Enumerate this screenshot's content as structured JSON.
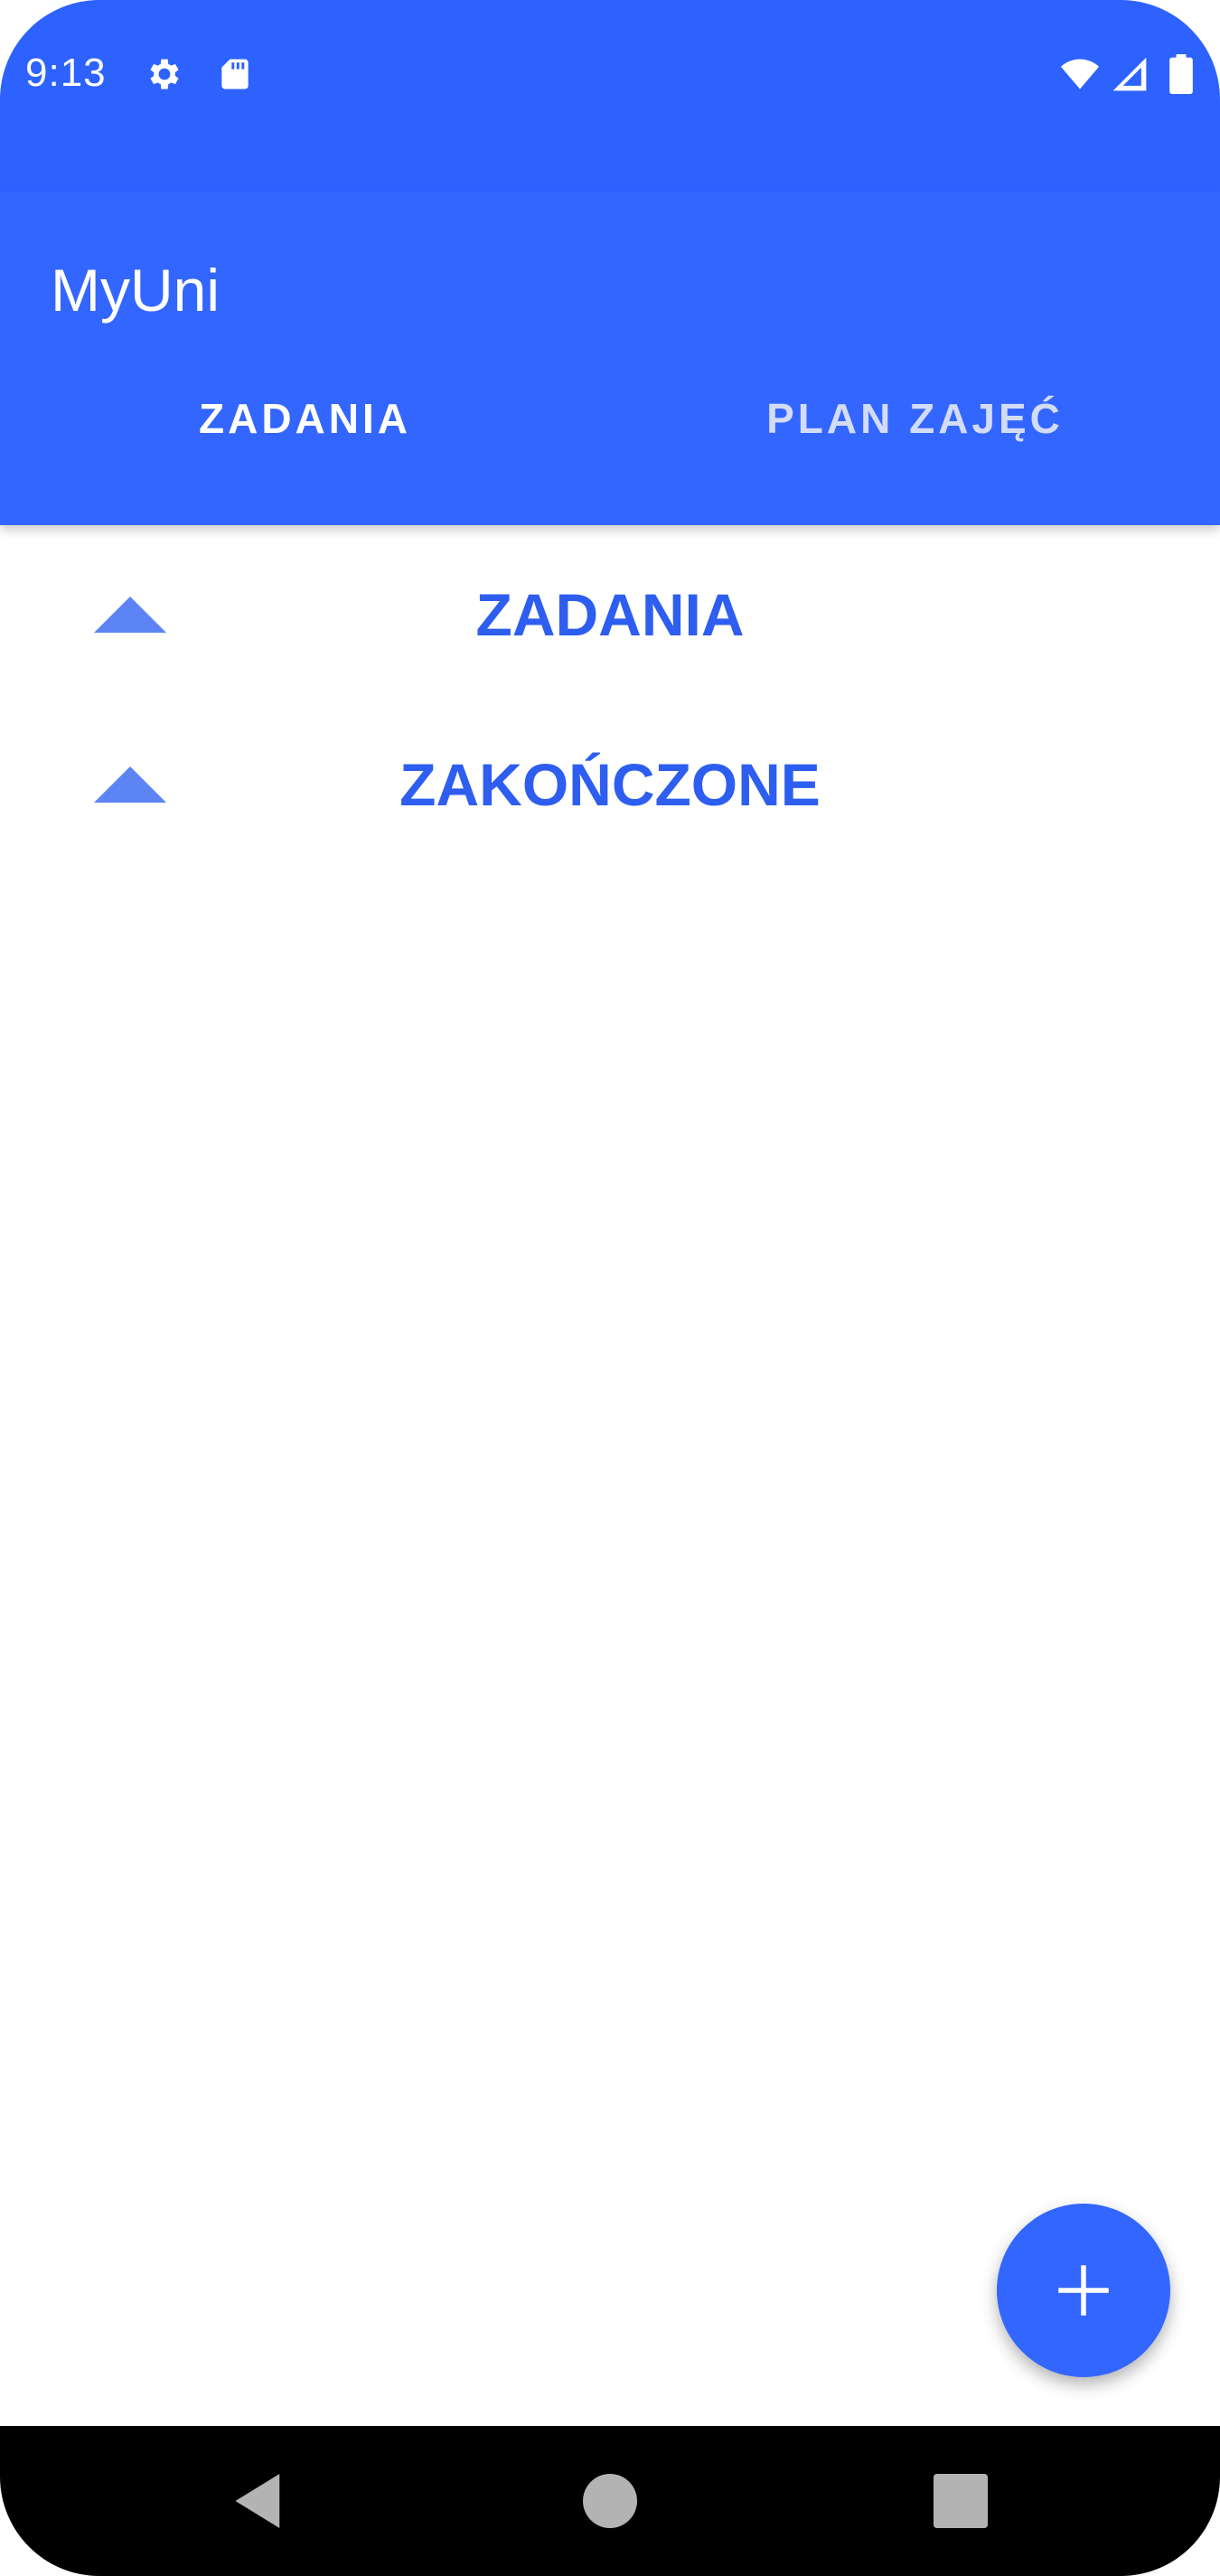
{
  "status_bar": {
    "time": "9:13",
    "icons_left": [
      "gear-icon",
      "sd-card-icon"
    ],
    "icons_right": [
      "wifi-icon",
      "cell-signal-icon",
      "battery-icon"
    ]
  },
  "app_bar": {
    "title": "MyUni",
    "tabs": [
      {
        "label": "ZADANIA",
        "active": true
      },
      {
        "label": "PLAN ZAJĘĆ",
        "active": false
      }
    ]
  },
  "sections": [
    {
      "label": "ZADANIA",
      "icon": "chevron-up-icon"
    },
    {
      "label": "ZAKOŃCZONE",
      "icon": "chevron-up-icon"
    }
  ],
  "fab": {
    "icon": "plus-icon"
  },
  "nav_bar": {
    "buttons": [
      "back-icon",
      "home-icon",
      "recents-icon"
    ]
  },
  "colors": {
    "status_bar": "#2d62ff",
    "app_bar": "#3366ff",
    "accent_text": "#2d5ef0",
    "arrow": "#5d84f5",
    "inactive_tab": "#d3dcf7",
    "nav_bar": "#000000"
  }
}
